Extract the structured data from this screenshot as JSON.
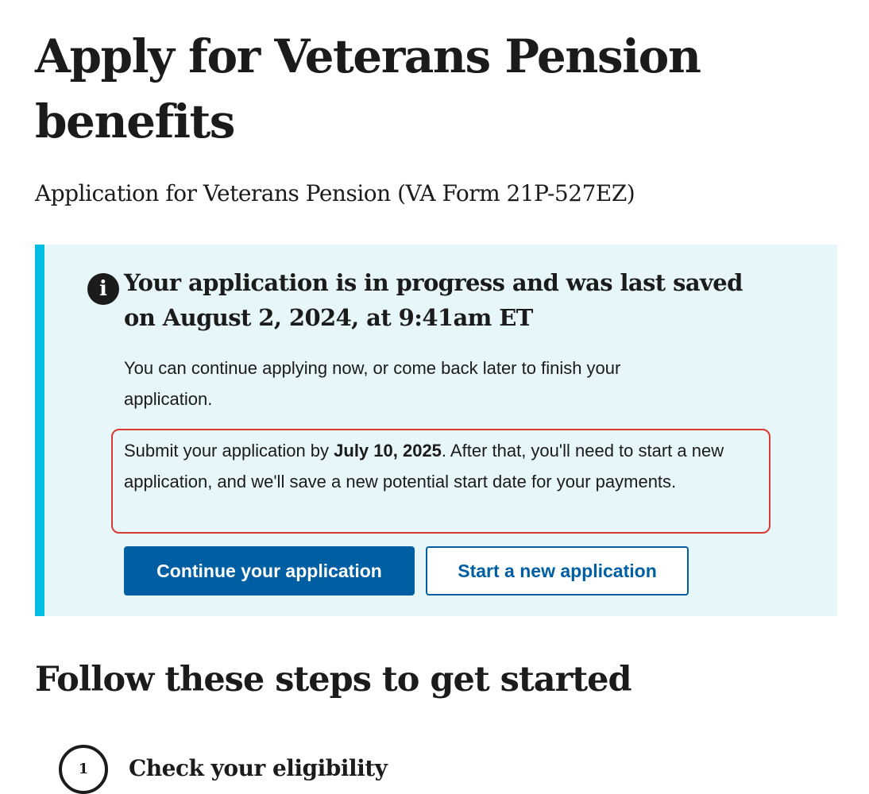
{
  "page": {
    "title": "Apply for Veterans Pension benefits",
    "subtitle": "Application for Veterans Pension (VA Form 21P-527EZ)"
  },
  "alert": {
    "icon": "info-icon",
    "icon_glyph": "i",
    "heading": "Your application is in progress and was last saved on August 2, 2024, at 9:41am ET",
    "body": "You can continue applying now, or come back later to finish your application.",
    "deadline_prefix": "Submit your application by ",
    "deadline_date": "July 10, 2025",
    "deadline_suffix": ". After that, you'll need to start a new application, and we'll save a new potential start date for your payments.",
    "continue_button": "Continue your application",
    "new_button": "Start a new application"
  },
  "steps_section": {
    "heading": "Follow these steps to get started",
    "steps": [
      {
        "number": "1",
        "label": "Check your eligibility"
      }
    ]
  },
  "colors": {
    "alert_background": "#e7f6f8",
    "alert_border": "#00bde3",
    "primary": "#005ea2",
    "highlight_border": "#d83933",
    "text": "#1b1b1b"
  }
}
